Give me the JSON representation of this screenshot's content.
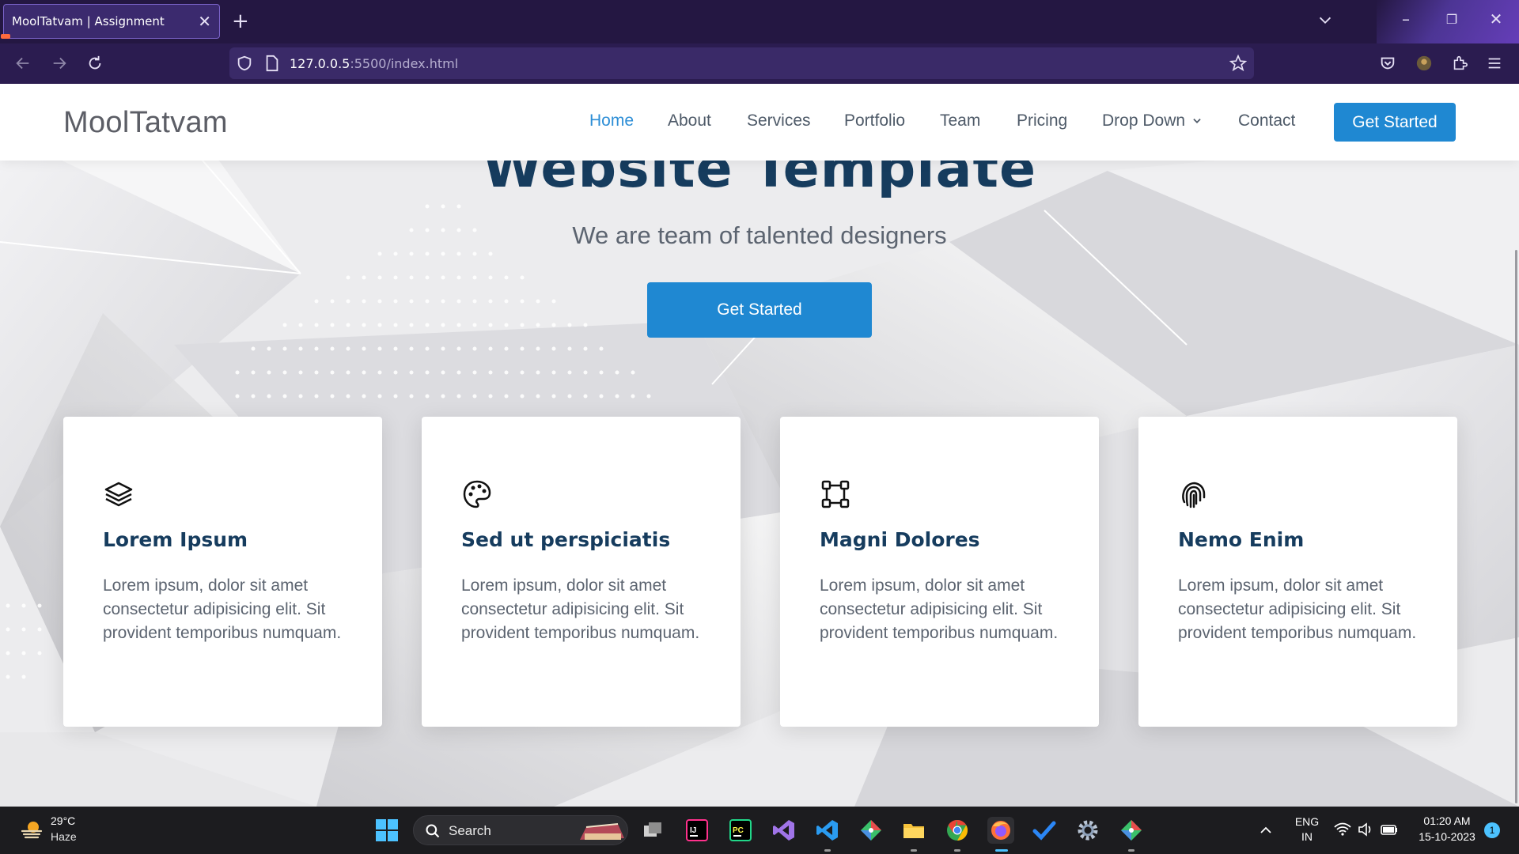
{
  "browser": {
    "tab_title": "MoolTatvam | Assignment",
    "url_host": "127.0.0.5",
    "url_rest": ":5500/index.html"
  },
  "site": {
    "logo": "MoolTatvam",
    "menu": [
      "Home",
      "About",
      "Services",
      "Portfolio",
      "Team",
      "Pricing",
      "Drop Down",
      "Contact"
    ],
    "active_menu": "Home",
    "header_cta": "Get Started"
  },
  "hero": {
    "title": "Website Template",
    "subtitle": "We are team of talented designers",
    "button": "Get Started"
  },
  "cards": [
    {
      "icon": "layers-icon",
      "title": "Lorem Ipsum",
      "text": "Lorem ipsum, dolor sit amet consectetur adipisicing elit. Sit provident temporibus numquam."
    },
    {
      "icon": "palette-icon",
      "title": "Sed ut perspiciatis",
      "text": "Lorem ipsum, dolor sit amet consectetur adipisicing elit. Sit provident temporibus numquam."
    },
    {
      "icon": "bounding-box-icon",
      "title": "Magni Dolores",
      "text": "Lorem ipsum, dolor sit amet consectetur adipisicing elit. Sit provident temporibus numquam."
    },
    {
      "icon": "fingerprint-icon",
      "title": "Nemo Enim",
      "text": "Lorem ipsum, dolor sit amet consectetur adipisicing elit. Sit provident temporibus numquam."
    }
  ],
  "taskbar": {
    "weather_temp": "29°C",
    "weather_desc": "Haze",
    "search_placeholder": "Search",
    "lang_line1": "ENG",
    "lang_line2": "IN",
    "time": "01:20 AM",
    "date": "15-10-2023",
    "notification_count": "1"
  },
  "colors": {
    "accent": "#1f88d2",
    "heading": "#163c5e",
    "browser_frame": "#241742"
  }
}
